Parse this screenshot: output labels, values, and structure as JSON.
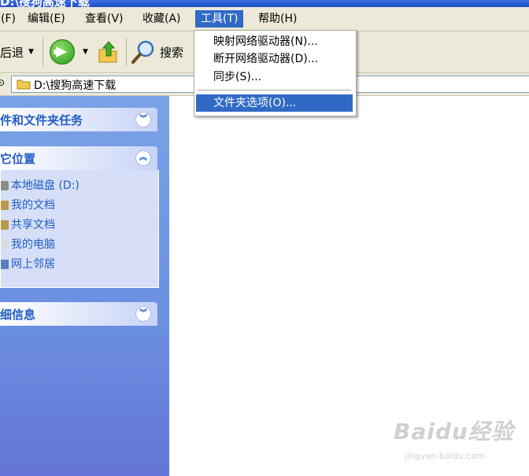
{
  "window": {
    "title": "D:\\搜狗高速下载"
  },
  "menubar": [
    {
      "label": "(F)"
    },
    {
      "label": "编辑(E)"
    },
    {
      "label": "查看(V)"
    },
    {
      "label": "收藏(A)"
    },
    {
      "label": "工具(T)",
      "open": true
    },
    {
      "label": "帮助(H)"
    }
  ],
  "toolbar": {
    "back_label": "后退",
    "search_label": "搜索"
  },
  "address": {
    "value": "D:\\搜狗高速下载"
  },
  "tools_menu": {
    "items": [
      {
        "label": "映射网络驱动器(N)..."
      },
      {
        "label": "断开网络驱动器(D)..."
      },
      {
        "label": "同步(S)..."
      },
      {
        "label": "文件夹选项(O)...",
        "highlighted": true
      }
    ]
  },
  "taskpane": {
    "file_tasks": {
      "title": "件和文件夹任务"
    },
    "other_places": {
      "title": "它位置",
      "items": [
        {
          "label": "本地磁盘 (D:)",
          "icon": "disk-icon"
        },
        {
          "label": "我的文档",
          "icon": "folder-icon"
        },
        {
          "label": "共享文档",
          "icon": "folder-icon"
        },
        {
          "label": "我的电脑",
          "icon": "computer-icon"
        },
        {
          "label": "网上邻居",
          "icon": "network-icon"
        }
      ]
    },
    "details": {
      "title": "细信息"
    }
  },
  "watermark": {
    "brand": "Baidu经验",
    "url": "jingyan.baidu.com"
  },
  "colors": {
    "menu_highlight": "#316ac5",
    "pane_title": "#215dc6",
    "pane_bg": "#6b8fe1",
    "chrome": "#ece9d8"
  }
}
